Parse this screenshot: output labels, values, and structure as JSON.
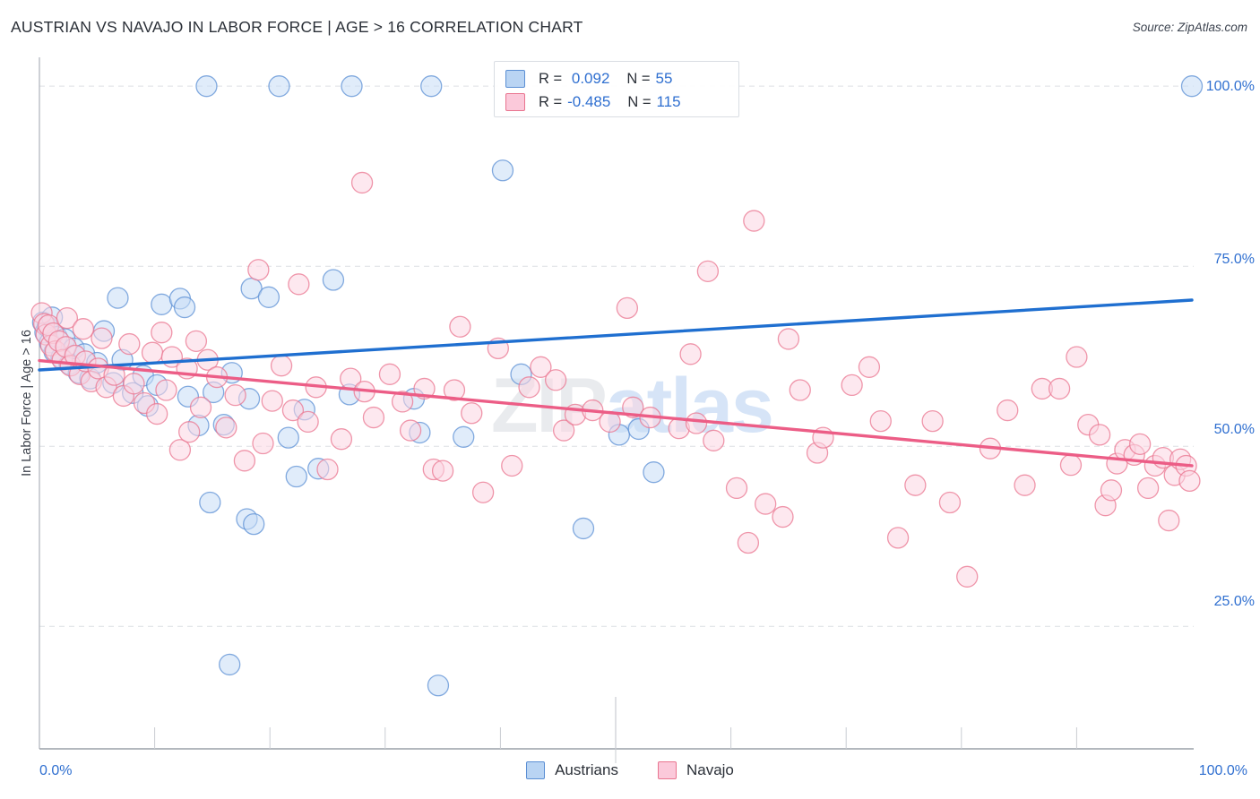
{
  "header": {
    "title": "AUSTRIAN VS NAVAJO IN LABOR FORCE | AGE > 16 CORRELATION CHART",
    "source": "Source: ZipAtlas.com"
  },
  "watermark": {
    "part1": "ZIP",
    "part2": "atlas"
  },
  "stats_legend": {
    "rows": [
      {
        "color_name": "blue-swatch",
        "r_key": "R = ",
        "r_value": " 0.092",
        "n_key": "N = ",
        "n_value": "55"
      },
      {
        "color_name": "pink-swatch",
        "r_key": "R = ",
        "r_value": "-0.485",
        "n_key": "N = ",
        "n_value": "115"
      }
    ]
  },
  "series_legend": [
    {
      "label": "Austrians",
      "color": "#b9d4f3"
    },
    {
      "label": "Navajo",
      "color": "#fbc9da"
    }
  ],
  "axes": {
    "ylabel": "In Labor Force | Age > 16",
    "yticks": [
      "100.0%",
      "75.0%",
      "50.0%",
      "25.0%"
    ],
    "xtick_left": "0.0%",
    "xtick_right": "100.0%"
  },
  "chart_data": {
    "type": "scatter",
    "title": "AUSTRIAN VS NAVAJO IN LABOR FORCE | AGE > 16 CORRELATION CHART",
    "xlabel": "",
    "ylabel": "In Labor Force | Age > 16",
    "xlim": [
      0,
      100
    ],
    "ylim": [
      8,
      104
    ],
    "grid": "horizontal-dashed",
    "legend_position": "bottom-center",
    "axis_tick_values_y": [
      100.0,
      75.0,
      50.0,
      25.0
    ],
    "axis_tick_values_x": [
      0.0,
      100.0
    ],
    "colors": {
      "austrians_fill": "#c6dcf5",
      "austrians_stroke": "#5b8fd4",
      "navajo_fill": "#fcd5e1",
      "navajo_stroke": "#e9748f",
      "austrians_trend": "#1f6fd0",
      "navajo_trend": "#ec5d86",
      "tick_text": "#2f6fd0"
    },
    "series": [
      {
        "name": "Austrians",
        "r": 0.092,
        "n": 55,
        "trendline": {
          "x0": 0,
          "y0": 60.6,
          "x1": 100,
          "y1": 70.3
        },
        "points": [
          [
            0.3,
            67.2
          ],
          [
            0.5,
            65.8
          ],
          [
            0.7,
            66.6
          ],
          [
            0.9,
            64.4
          ],
          [
            1.1,
            67.9
          ],
          [
            1.3,
            63.1
          ],
          [
            1.5,
            65.2
          ],
          [
            1.9,
            62.3
          ],
          [
            2.2,
            64.9
          ],
          [
            2.6,
            61.4
          ],
          [
            3.0,
            63.6
          ],
          [
            3.4,
            60.2
          ],
          [
            3.9,
            62.8
          ],
          [
            4.4,
            59.4
          ],
          [
            5.0,
            61.6
          ],
          [
            5.6,
            66.0
          ],
          [
            6.4,
            58.8
          ],
          [
            7.2,
            62.0
          ],
          [
            8.1,
            57.4
          ],
          [
            9.0,
            59.8
          ],
          [
            6.8,
            70.6
          ],
          [
            10.6,
            69.7
          ],
          [
            12.2,
            70.5
          ],
          [
            12.6,
            69.3
          ],
          [
            9.4,
            55.6
          ],
          [
            10.2,
            58.5
          ],
          [
            14.5,
            100.0
          ],
          [
            20.8,
            100.0
          ],
          [
            27.1,
            100.0
          ],
          [
            34.0,
            100.0
          ],
          [
            100.0,
            100.0
          ],
          [
            40.2,
            88.3
          ],
          [
            25.5,
            73.1
          ],
          [
            18.4,
            71.9
          ],
          [
            19.9,
            70.7
          ],
          [
            13.8,
            52.9
          ],
          [
            12.9,
            56.9
          ],
          [
            15.1,
            57.5
          ],
          [
            16.7,
            60.2
          ],
          [
            18.2,
            56.6
          ],
          [
            16.0,
            53.0
          ],
          [
            21.6,
            51.2
          ],
          [
            23.0,
            55.1
          ],
          [
            24.2,
            46.9
          ],
          [
            22.3,
            45.8
          ],
          [
            14.8,
            42.2
          ],
          [
            18.0,
            39.9
          ],
          [
            18.6,
            39.2
          ],
          [
            26.9,
            57.2
          ],
          [
            32.5,
            56.6
          ],
          [
            33.0,
            51.9
          ],
          [
            36.8,
            51.3
          ],
          [
            41.8,
            60.0
          ],
          [
            50.3,
            51.6
          ],
          [
            52.0,
            52.4
          ],
          [
            53.3,
            46.4
          ],
          [
            47.2,
            38.6
          ],
          [
            16.5,
            19.7
          ],
          [
            34.6,
            16.8
          ]
        ]
      },
      {
        "name": "Navajo",
        "r": -0.485,
        "n": 115,
        "trendline": {
          "x0": 0,
          "y0": 61.9,
          "x1": 100,
          "y1": 47.3
        },
        "points": [
          [
            0.2,
            68.5
          ],
          [
            0.4,
            67.0
          ],
          [
            0.6,
            65.5
          ],
          [
            0.8,
            66.8
          ],
          [
            1.0,
            64.0
          ],
          [
            1.2,
            65.7
          ],
          [
            1.4,
            63.2
          ],
          [
            1.7,
            64.6
          ],
          [
            2.0,
            62.0
          ],
          [
            2.3,
            63.8
          ],
          [
            2.7,
            61.2
          ],
          [
            3.1,
            62.6
          ],
          [
            3.5,
            60.0
          ],
          [
            4.0,
            61.8
          ],
          [
            4.5,
            59.0
          ],
          [
            5.1,
            60.8
          ],
          [
            5.8,
            58.2
          ],
          [
            6.5,
            59.9
          ],
          [
            7.3,
            57.0
          ],
          [
            8.2,
            58.7
          ],
          [
            9.1,
            56.0
          ],
          [
            2.4,
            67.8
          ],
          [
            3.8,
            66.3
          ],
          [
            5.4,
            65.0
          ],
          [
            7.8,
            64.2
          ],
          [
            9.8,
            63.0
          ],
          [
            10.6,
            65.8
          ],
          [
            11.5,
            62.4
          ],
          [
            12.8,
            60.8
          ],
          [
            13.6,
            64.6
          ],
          [
            14.6,
            62.0
          ],
          [
            28.0,
            86.6
          ],
          [
            62.0,
            81.3
          ],
          [
            58.0,
            74.3
          ],
          [
            19.0,
            74.5
          ],
          [
            22.5,
            72.5
          ],
          [
            51.0,
            69.2
          ],
          [
            36.5,
            66.6
          ],
          [
            65.0,
            64.9
          ],
          [
            56.5,
            62.8
          ],
          [
            90.0,
            62.4
          ],
          [
            10.2,
            54.5
          ],
          [
            11.0,
            57.8
          ],
          [
            12.2,
            49.5
          ],
          [
            13.0,
            52.0
          ],
          [
            14.0,
            55.4
          ],
          [
            15.4,
            59.6
          ],
          [
            16.2,
            52.6
          ],
          [
            17.0,
            57.1
          ],
          [
            17.8,
            48.0
          ],
          [
            19.4,
            50.4
          ],
          [
            20.2,
            56.3
          ],
          [
            21.0,
            61.2
          ],
          [
            22.0,
            55.0
          ],
          [
            23.3,
            53.4
          ],
          [
            24.0,
            58.2
          ],
          [
            25.0,
            46.8
          ],
          [
            26.2,
            51.0
          ],
          [
            27.0,
            59.4
          ],
          [
            28.2,
            57.6
          ],
          [
            29.0,
            54.0
          ],
          [
            30.4,
            60.0
          ],
          [
            31.5,
            56.2
          ],
          [
            32.2,
            52.2
          ],
          [
            33.4,
            58.0
          ],
          [
            34.2,
            46.8
          ],
          [
            35.0,
            46.6
          ],
          [
            36.0,
            57.8
          ],
          [
            37.5,
            54.6
          ],
          [
            38.5,
            43.6
          ],
          [
            39.8,
            63.6
          ],
          [
            41.0,
            47.3
          ],
          [
            42.5,
            58.2
          ],
          [
            43.5,
            61.0
          ],
          [
            44.8,
            59.2
          ],
          [
            45.5,
            52.2
          ],
          [
            46.5,
            54.4
          ],
          [
            48.0,
            55.0
          ],
          [
            49.5,
            53.4
          ],
          [
            51.5,
            55.4
          ],
          [
            53.0,
            54.0
          ],
          [
            55.5,
            52.5
          ],
          [
            57.0,
            53.2
          ],
          [
            58.5,
            50.8
          ],
          [
            60.5,
            44.2
          ],
          [
            61.5,
            36.6
          ],
          [
            63.0,
            42.0
          ],
          [
            64.5,
            40.2
          ],
          [
            66.0,
            57.8
          ],
          [
            67.5,
            49.1
          ],
          [
            68.0,
            51.2
          ],
          [
            70.5,
            58.5
          ],
          [
            72.0,
            61.0
          ],
          [
            73.0,
            53.5
          ],
          [
            74.5,
            37.3
          ],
          [
            76.0,
            44.6
          ],
          [
            77.5,
            53.5
          ],
          [
            79.0,
            42.2
          ],
          [
            80.5,
            31.9
          ],
          [
            82.5,
            49.7
          ],
          [
            84.0,
            55.0
          ],
          [
            85.5,
            44.6
          ],
          [
            87.0,
            58.0
          ],
          [
            88.5,
            58.0
          ],
          [
            89.5,
            47.4
          ],
          [
            91.0,
            53.0
          ],
          [
            92.0,
            51.6
          ],
          [
            92.5,
            41.8
          ],
          [
            93.0,
            43.9
          ],
          [
            93.5,
            47.6
          ],
          [
            94.2,
            49.5
          ],
          [
            95.0,
            48.8
          ],
          [
            95.5,
            50.3
          ],
          [
            96.2,
            44.2
          ],
          [
            96.8,
            47.3
          ],
          [
            97.5,
            48.4
          ],
          [
            98.0,
            39.7
          ],
          [
            98.5,
            46.0
          ],
          [
            99.0,
            48.2
          ],
          [
            99.5,
            47.3
          ],
          [
            99.8,
            45.2
          ]
        ]
      }
    ]
  }
}
